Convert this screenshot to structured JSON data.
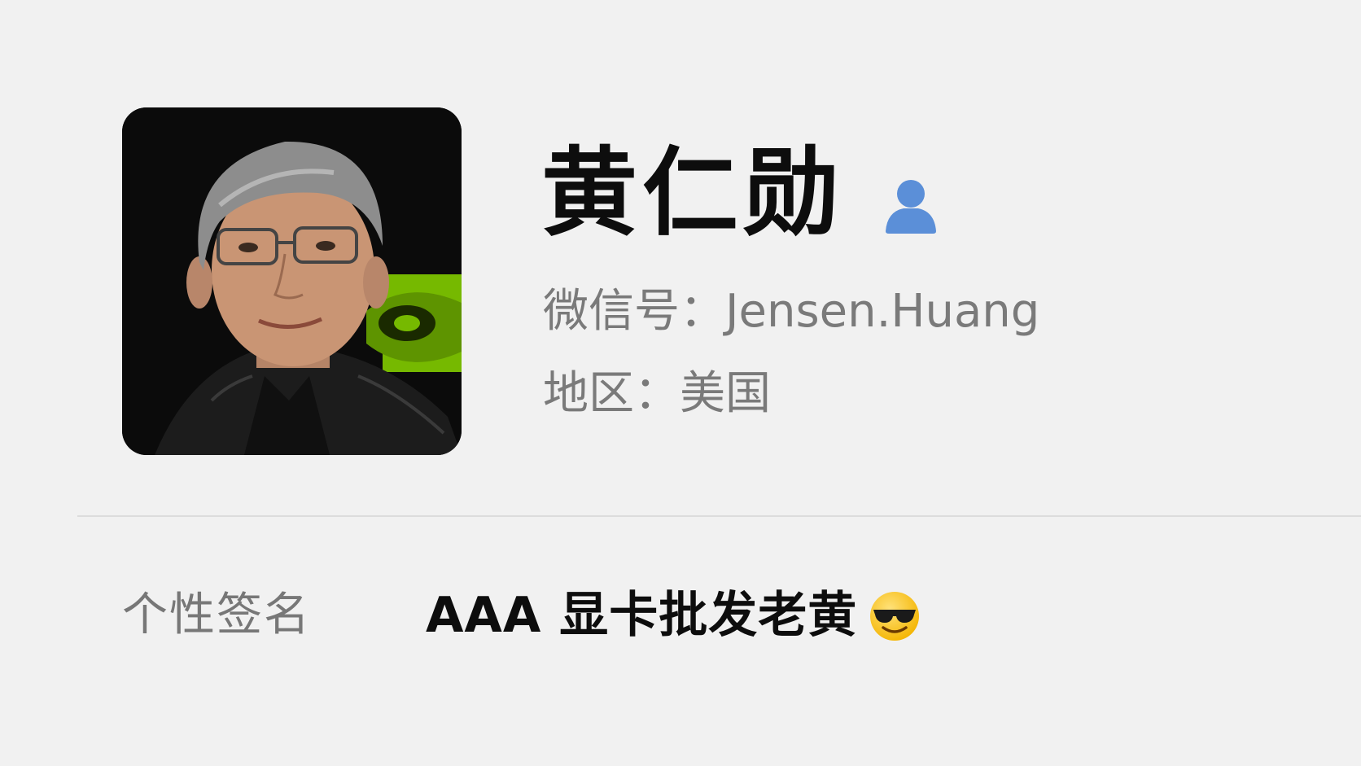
{
  "profile": {
    "name": "黄仁勋",
    "wechat_label": "微信号：",
    "wechat_id": "Jensen.Huang",
    "region_label": "地区：",
    "region_value": "美国",
    "avatar_icon": "person-photo-avatar",
    "contact_icon": "contact-person-icon"
  },
  "signature": {
    "label": "个性签名",
    "text": "AAA 显卡批发老黄",
    "emoji_icon": "smiling-face-with-sunglasses-emoji"
  },
  "colors": {
    "background": "#f1f1f1",
    "name": "#0d0d0d",
    "secondary_text": "#7a7a7a",
    "contact_icon": "#5b8fd8",
    "brand_green": "#76b900",
    "divider": "#dcdcdc"
  }
}
